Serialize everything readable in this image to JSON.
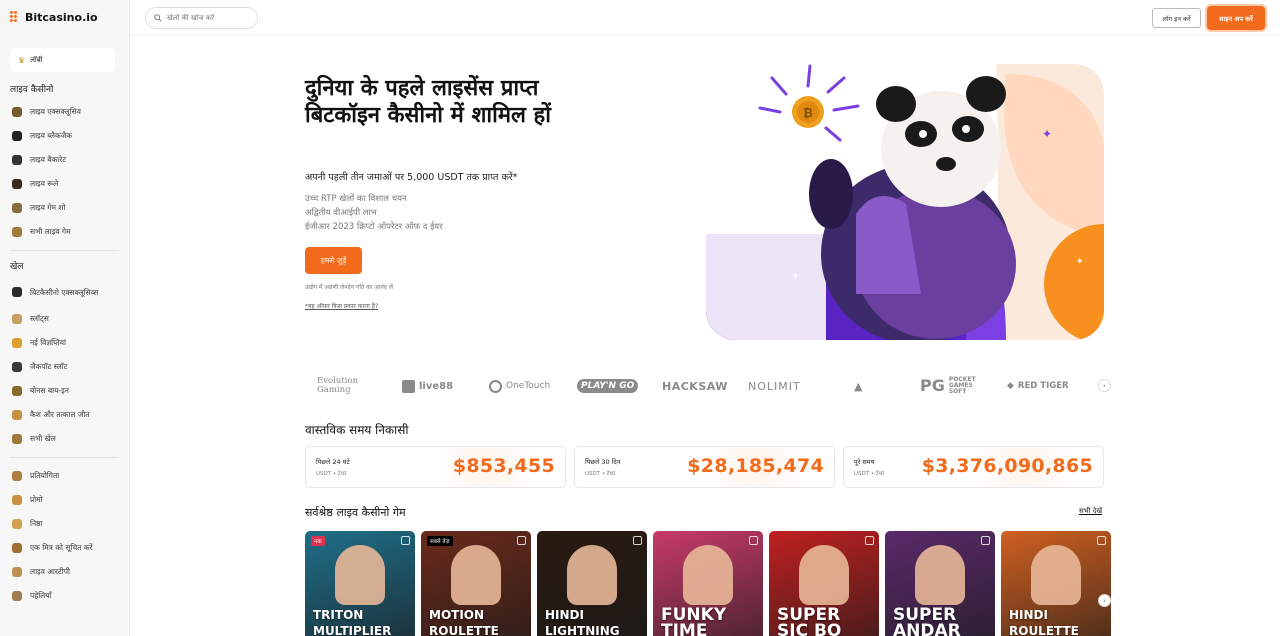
{
  "brand": {
    "name": "Bitcasino.io"
  },
  "header": {
    "search_placeholder": "खेलों की खोज करें",
    "login_label": "लॉग इन करें",
    "signup_label": "साइन अप करें"
  },
  "sidebar": {
    "lobby_label": "लॉबी",
    "sections": [
      {
        "title": "लाइव कैसीनो",
        "items": [
          {
            "label": "लाइव एक्सक्लूसिव",
            "icon": "live-exclusive-icon",
            "color": "#7a5a2a"
          },
          {
            "label": "लाइव ब्लैकजैक",
            "icon": "spade-icon",
            "color": "#222222"
          },
          {
            "label": "लाइव बैकारेट",
            "icon": "cards-icon",
            "color": "#333333"
          },
          {
            "label": "लाइव रूले",
            "icon": "roulette-icon",
            "color": "#3a2a1a"
          },
          {
            "label": "लाइव गेम शो",
            "icon": "game-show-icon",
            "color": "#8a6a3a"
          },
          {
            "label": "सभी लाइव गेम",
            "icon": "grid-icon",
            "color": "#a07a3a"
          }
        ]
      },
      {
        "title": "खेल",
        "items": [
          {
            "label": "बिटकैसीनो एक्सक्लूसिव्स",
            "icon": "bitcasino-exclusive-icon",
            "color": "#2a2a2a"
          },
          {
            "label": "स्लॉट्स",
            "icon": "cherry-icon",
            "color": "#c8a060"
          },
          {
            "label": "नई विज्ञप्तियां",
            "icon": "new-icon",
            "color": "#e0a030"
          },
          {
            "label": "जैकपॉट स्लॉट",
            "icon": "jackpot-icon",
            "color": "#3a3a3a"
          },
          {
            "label": "बोनस बाय-इन",
            "icon": "bonus-icon",
            "color": "#8a6a2a"
          },
          {
            "label": "कैश और तत्काल जीत",
            "icon": "cash-icon",
            "color": "#c89040"
          },
          {
            "label": "सभी खेल",
            "icon": "grid-icon",
            "color": "#a07a3a"
          }
        ]
      },
      {
        "title": "",
        "items": [
          {
            "label": "प्रतियोगिता",
            "icon": "trophy-icon",
            "color": "#b08040"
          },
          {
            "label": "प्रोमो",
            "icon": "promo-icon",
            "color": "#c89040"
          },
          {
            "label": "निष्ठा",
            "icon": "loyalty-icon",
            "color": "#d0a050"
          },
          {
            "label": "एक मित्र को सूचित करें",
            "icon": "refer-icon",
            "color": "#a07030"
          },
          {
            "label": "लाइव आरटीपी",
            "icon": "percent-icon",
            "color": "#c09050"
          },
          {
            "label": "पहेलियाँ",
            "icon": "puzzle-icon",
            "color": "#a08050"
          }
        ]
      }
    ]
  },
  "hero": {
    "title": "दुनिया के पहले लाइसेंस प्राप्त बिटकॉइन कैसीनो में शामिल हों",
    "subtitle": "अपनी पहली तीन जमाओं पर 5,000 USDT तक प्राप्त करें*",
    "features": [
      "उच्च RTP खेलों का विशाल चयन",
      "अद्वितीय वीआईपी लाभ",
      "ईजीआर 2023 क्रिप्टो ऑपरेटर ऑफ द ईयर"
    ],
    "cta_label": "हमसे जुड़ें",
    "note": "उद्योग में अग्रणी लेनदेन गति का आनंद लें",
    "terms_link": "*यह ऑफ़र किस प्रकार करता है?"
  },
  "providers": [
    {
      "name": "Evolution Gaming"
    },
    {
      "name": "live88"
    },
    {
      "name": "OneTouch"
    },
    {
      "name": "PLAY'N GO"
    },
    {
      "name": "HACKSAW"
    },
    {
      "name": "NOLIMIT"
    },
    {
      "name": ""
    },
    {
      "name": "POCKET GAMES SOFT"
    },
    {
      "name": "RED TIGER"
    }
  ],
  "withdrawals": {
    "title": "वास्तविक समय निकासी",
    "cards": [
      {
        "label": "पिछले 24 घंटे",
        "unit": "USDT • टेथर",
        "amount": "$853,455"
      },
      {
        "label": "पिछले 30 दिन",
        "unit": "USDT • टेथर",
        "amount": "$28,185,474"
      },
      {
        "label": "पूरे समय",
        "unit": "USDT • टेथर",
        "amount": "$3,376,090,865"
      }
    ]
  },
  "live_games": {
    "title": "सर्वश्रेष्ठ लाइव कैसीनो गेम",
    "see_all": "सभी देखें",
    "games": [
      {
        "name": "TRITON MULTIPLIER",
        "tag": "नया",
        "tag_color": "#e03050",
        "bg": "#1f6f8a"
      },
      {
        "name": "MOTION ROULETTE",
        "tag": "सबसे तेज़",
        "tag_color": "#000000",
        "bg": "#6a2a1a"
      },
      {
        "name": "HINDI LIGHTNING",
        "tag": "",
        "tag_color": "",
        "bg": "#2a1a10"
      },
      {
        "name": "FUNKY TIME",
        "tag": "",
        "tag_color": "",
        "bg": "#c83a6a"
      },
      {
        "name": "SUPER SIC BO",
        "tag": "",
        "tag_color": "",
        "bg": "#c02020"
      },
      {
        "name": "SUPER ANDAR",
        "tag": "",
        "tag_color": "",
        "bg": "#5a2a6a"
      },
      {
        "name": "HINDI ROULETTE",
        "tag": "",
        "tag_color": "",
        "bg": "#d06020"
      }
    ]
  },
  "colors": {
    "accent": "#f26b1d",
    "purple": "#6b2fd6"
  }
}
